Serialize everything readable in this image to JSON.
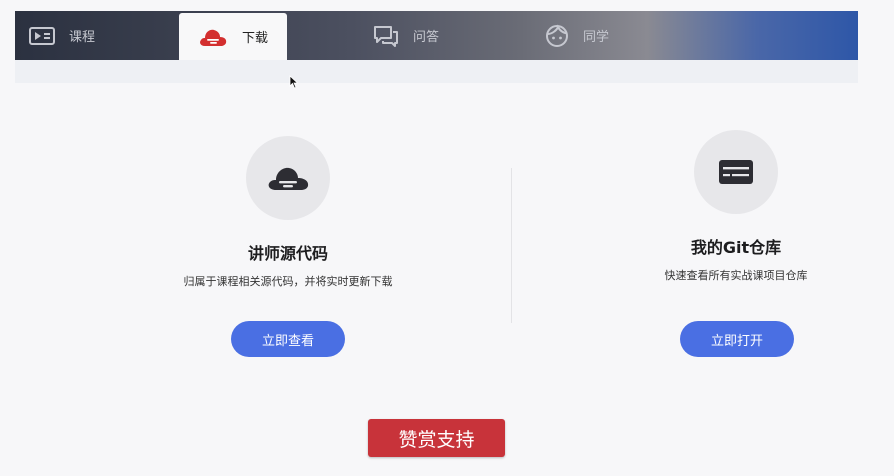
{
  "tabs": [
    {
      "label": "课程",
      "icon": "course-icon"
    },
    {
      "label": "下载",
      "icon": "cloud-download-icon",
      "active": true
    },
    {
      "label": "问答",
      "icon": "chat-icon"
    },
    {
      "label": "同学",
      "icon": "face-icon"
    }
  ],
  "cards": {
    "source": {
      "title": "讲师源代码",
      "desc": "归属于课程相关源代码，并将实时更新下载",
      "button": "立即查看",
      "icon": "cloud-code-icon"
    },
    "git": {
      "title": "我的Git仓库",
      "desc": "快速查看所有实战课项目仓库",
      "button": "立即打开",
      "icon": "repository-icon"
    }
  },
  "reward_button": "赞赏支持",
  "colors": {
    "accent": "#4a6fe3",
    "reward": "#c8333a",
    "active_icon": "#d32f2f"
  }
}
